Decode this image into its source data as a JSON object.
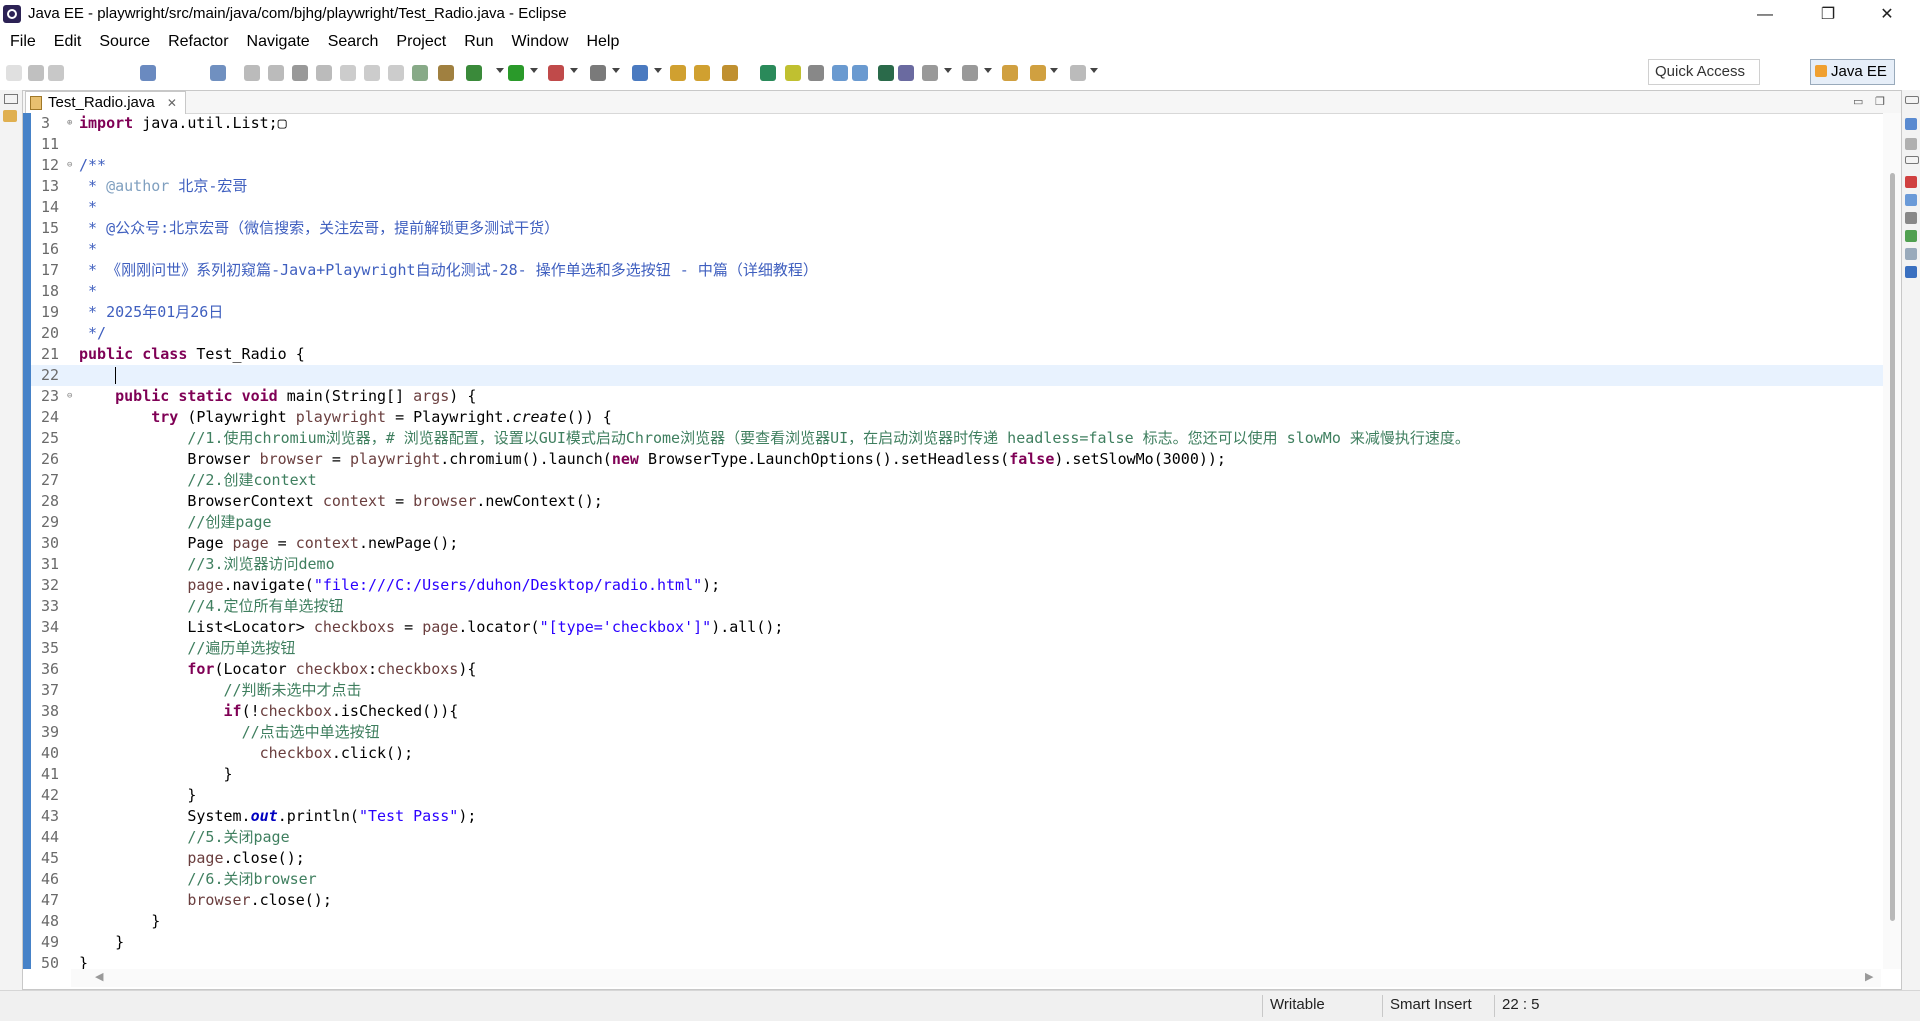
{
  "window": {
    "title": "Java EE - playwright/src/main/java/com/bjhg/playwright/Test_Radio.java - Eclipse",
    "minimize_glyph": "—",
    "restore_glyph": "❐",
    "close_glyph": "✕"
  },
  "menu": [
    "File",
    "Edit",
    "Source",
    "Refactor",
    "Navigate",
    "Search",
    "Project",
    "Run",
    "Window",
    "Help"
  ],
  "toolbar": {
    "quick_access_label": "Quick Access",
    "perspective_label": "Java EE"
  },
  "editor": {
    "tab_label": "Test_Radio.java",
    "tab_close_glyph": "✕"
  },
  "code_lines": [
    {
      "n": "3",
      "fold": "⊕",
      "html": "<span class=\"kw\">import</span> java.util.List;▢"
    },
    {
      "n": "11",
      "html": ""
    },
    {
      "n": "12",
      "fold": "⊖",
      "html": "<span class=\"jd\">/**</span>"
    },
    {
      "n": "13",
      "html": "<span class=\"jd\"> * <b style=\"color:#7f9fbf;font-weight:normal\">@author</b> 北京-宏哥</span>"
    },
    {
      "n": "14",
      "html": "<span class=\"jd\"> *</span>"
    },
    {
      "n": "15",
      "html": "<span class=\"jd\"> * @公众号:北京宏哥（微信搜索，关注宏哥，提前解锁更多测试干货）</span>"
    },
    {
      "n": "16",
      "html": "<span class=\"jd\"> *</span>"
    },
    {
      "n": "17",
      "html": "<span class=\"jd\"> * 《刚刚问世》系列初窥篇-Java+Playwright自动化测试-28- 操作单选和多选按钮 - 中篇（详细教程）</span>"
    },
    {
      "n": "18",
      "html": "<span class=\"jd\"> *</span>"
    },
    {
      "n": "19",
      "html": "<span class=\"jd\"> * 2025年01月26日</span>"
    },
    {
      "n": "20",
      "html": "<span class=\"jd\"> */</span>"
    },
    {
      "n": "21",
      "html": "<span class=\"kw\">public</span> <span class=\"kw\">class</span> Test_Radio {"
    },
    {
      "n": "22",
      "html": "    <span class=\"caret\"></span>",
      "current": true
    },
    {
      "n": "23",
      "fold": "⊖",
      "html": "    <span class=\"kw\">public</span> <span class=\"kw\">static</span> <span class=\"kw\">void</span> main(String[] <span class=\"var\">args</span>) {"
    },
    {
      "n": "24",
      "html": "        <span class=\"kw\">try</span> (Playwright <span class=\"var\">playwright</span> = Playwright.<span class=\"it\">create</span>()) {"
    },
    {
      "n": "25",
      "html": "            <span class=\"cm\">//1.使用chromium浏览器，# 浏览器配置，设置以GUI模式启动Chrome浏览器（要查看浏览器UI，在启动浏览器时传递 headless=false 标志。您还可以使用 slowMo 来减慢执行速度。</span>"
    },
    {
      "n": "26",
      "html": "            Browser <span class=\"var\">browser</span> = <span class=\"var\">playwright</span>.chromium().launch(<span class=\"kw\">new</span> BrowserType.LaunchOptions().setHeadless(<span class=\"kw\">false</span>).setSlowMo(3000));"
    },
    {
      "n": "27",
      "html": "            <span class=\"cm\">//2.创建context</span>"
    },
    {
      "n": "28",
      "html": "            BrowserContext <span class=\"var\">context</span> = <span class=\"var\">browser</span>.newContext();"
    },
    {
      "n": "29",
      "html": "            <span class=\"cm\">//创建page</span>"
    },
    {
      "n": "30",
      "html": "            Page <span class=\"var\">page</span> = <span class=\"var\">context</span>.newPage();"
    },
    {
      "n": "31",
      "html": "            <span class=\"cm\">//3.浏览器访问demo</span>"
    },
    {
      "n": "32",
      "html": "            <span class=\"var\">page</span>.navigate(<span class=\"str\">\"file:///C:/Users/duhon/Desktop/radio.html\"</span>);"
    },
    {
      "n": "33",
      "html": "            <span class=\"cm\">//4.定位所有单选按钮</span>"
    },
    {
      "n": "34",
      "html": "            List&lt;Locator&gt; <span class=\"var\">checkboxs</span> = <span class=\"var\">page</span>.locator(<span class=\"str\">\"[type='checkbox']\"</span>).all();"
    },
    {
      "n": "35",
      "html": "            <span class=\"cm\">//遍历单选按钮</span>"
    },
    {
      "n": "36",
      "html": "            <span class=\"kw\">for</span>(Locator <span class=\"var\">checkbox</span>:<span class=\"var\">checkboxs</span>){"
    },
    {
      "n": "37",
      "html": "                <span class=\"cm\">//判断未选中才点击</span>"
    },
    {
      "n": "38",
      "html": "                <span class=\"kw\">if</span>(!<span class=\"var\">checkbox</span>.isChecked()){"
    },
    {
      "n": "39",
      "html": "                  <span class=\"cm\">//点击选中单选按钮</span>"
    },
    {
      "n": "40",
      "html": "                    <span class=\"var\">checkbox</span>.click();"
    },
    {
      "n": "41",
      "html": "                }"
    },
    {
      "n": "42",
      "html": "            }"
    },
    {
      "n": "43",
      "html": "            System.<span class=\"fld\">out</span>.println(<span class=\"str\">\"Test Pass\"</span>);"
    },
    {
      "n": "44",
      "html": "            <span class=\"cm\">//5.关闭page</span>"
    },
    {
      "n": "45",
      "html": "            <span class=\"var\">page</span>.close();"
    },
    {
      "n": "46",
      "html": "            <span class=\"cm\">//6.关闭browser</span>"
    },
    {
      "n": "47",
      "html": "            <span class=\"var\">browser</span>.close();"
    },
    {
      "n": "48",
      "html": "        }"
    },
    {
      "n": "49",
      "html": "    }"
    },
    {
      "n": "50",
      "html": "}"
    }
  ],
  "status": {
    "writable": "Writable",
    "insert_mode": "Smart Insert",
    "position": "22 : 5"
  },
  "colors": {
    "keyword": "#7f0055",
    "comment": "#3f7f5f",
    "javadoc": "#3f5fbf",
    "string": "#2a00ff",
    "local_variable": "#6a3e3e",
    "current_line": "#e8f2fe"
  }
}
